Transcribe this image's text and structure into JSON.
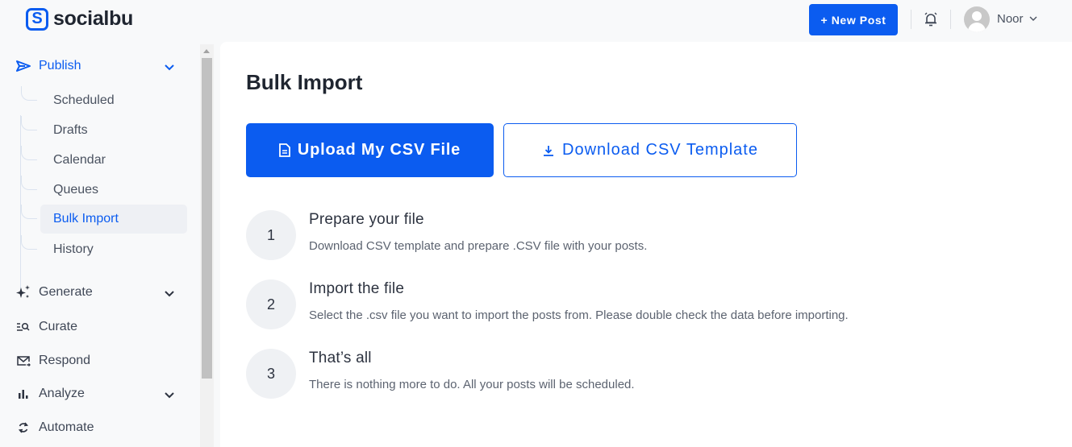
{
  "brand": {
    "name": "socialbu",
    "accent": "#0b5cf0"
  },
  "header": {
    "new_post_label": "+ New Post",
    "user_name": "Noor",
    "user_caret": "⌄"
  },
  "sidebar": {
    "publish": {
      "label": "Publish",
      "expanded": true
    },
    "publish_items": [
      {
        "label": "Scheduled"
      },
      {
        "label": "Drafts"
      },
      {
        "label": "Calendar"
      },
      {
        "label": "Queues"
      },
      {
        "label": "Bulk Import",
        "active": true
      },
      {
        "label": "History"
      }
    ],
    "sections": [
      {
        "label": "Generate",
        "has_caret": true
      },
      {
        "label": "Curate",
        "has_caret": false
      },
      {
        "label": "Respond",
        "has_caret": false
      },
      {
        "label": "Analyze",
        "has_caret": true
      },
      {
        "label": "Automate",
        "has_caret": false
      }
    ]
  },
  "main": {
    "title": "Bulk Import",
    "upload_label": "Upload My CSV File",
    "download_label": "Download CSV Template",
    "steps": [
      {
        "number": "1",
        "title": "Prepare your file",
        "description": "Download CSV template and prepare .CSV file with your posts."
      },
      {
        "number": "2",
        "title": "Import the file",
        "description": "Select the .csv file you want to import the posts from. Please double check the data before importing."
      },
      {
        "number": "3",
        "title": "That’s all",
        "description": "There is nothing more to do. All your posts will be scheduled."
      }
    ]
  }
}
